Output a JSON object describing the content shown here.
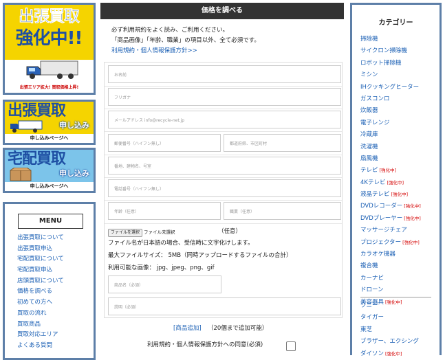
{
  "banners": {
    "b1_line1": "出張買取",
    "b1_line2": "強化中!!",
    "b1_foot": "出張エリア拡大! 買取価格上昇!",
    "b2_title": "出張買取",
    "b2_sub": "申し込み",
    "b2_foot": "申し込みページへ",
    "b3_title": "宅配買取",
    "b3_sub": "申し込み",
    "b3_foot": "申し込みページへ"
  },
  "menu": {
    "title": "MENU",
    "items": [
      "出張買取について",
      "出張買取申込",
      "宅配買取について",
      "宅配買取申込",
      "店頭買取について",
      "価格を調べる",
      "初めての方へ",
      "買取の流れ",
      "買取商品",
      "買取対応エリア",
      "よくある質問"
    ]
  },
  "form": {
    "header": "価格を調べる",
    "intro1": "必ず利用規約をよく読み、ご利用ください。",
    "intro2": "「商品画像」「年齢、職業」の項目以外、全て必須です。",
    "terms_link": "利用規約・個人情報保護方針>>",
    "placeholders": {
      "name": "お名前",
      "furigana": "フリガナ",
      "email": "メールアドレス info@recycle-net.jp",
      "zip": "郵便番号（ハイフン無し）",
      "pref": "都道府県、市区町村",
      "address": "番地、建物名、号室",
      "phone": "電話番号（ハイフン無し）",
      "age": "年齢（任意）",
      "job": "職業（任意）",
      "product": "商品名（必須）",
      "desc": "説明（必須）"
    },
    "file_button": "ファイルを選択",
    "file_status": "ファイル未選択",
    "optional": "（任意）",
    "note1": "ファイル名が日本語の場合、受信時に文字化けします。",
    "note2": "最大ファイルサイズ： 5MB（同時アップロードするファイルの合計）",
    "note3": "利用可能な画像： jpg、jpeg、png、gif",
    "add_link": "[商品追加]",
    "add_note": "（20個まで追加可能）",
    "agree_label": "利用規約・個人情報保護方針への同意(必須)"
  },
  "categories": {
    "title": "カテゴリー",
    "tag_text": "[強化中]",
    "items": [
      {
        "label": "掃除機",
        "tag": false
      },
      {
        "label": "サイクロン掃除機",
        "tag": false
      },
      {
        "label": "ロボット掃除機",
        "tag": false
      },
      {
        "label": "ミシン",
        "tag": false
      },
      {
        "label": "IHクッキングヒーター",
        "tag": false
      },
      {
        "label": "ガスコンロ",
        "tag": false
      },
      {
        "label": "炊飯器",
        "tag": false
      },
      {
        "label": "電子レンジ",
        "tag": false
      },
      {
        "label": "冷蔵庫",
        "tag": false
      },
      {
        "label": "洗濯機",
        "tag": false
      },
      {
        "label": "扇風機",
        "tag": false
      },
      {
        "label": "テレビ",
        "tag": true
      },
      {
        "label": "4Kテレビ",
        "tag": true
      },
      {
        "label": "液晶テレビ",
        "tag": true
      },
      {
        "label": "DVDレコーダー",
        "tag": true
      },
      {
        "label": "DVDプレーヤー",
        "tag": true
      },
      {
        "label": "マッサージチェア",
        "tag": false
      },
      {
        "label": "プロジェクター",
        "tag": true
      },
      {
        "label": "カラオケ機器",
        "tag": false
      },
      {
        "label": "複合機",
        "tag": false
      },
      {
        "label": "カーナビ",
        "tag": false
      },
      {
        "label": "ドローン",
        "tag": false
      },
      {
        "label": "美容器具",
        "tag": true
      }
    ],
    "brands": [
      {
        "label": "ソニー",
        "tag": false
      },
      {
        "label": "タイガー",
        "tag": false
      },
      {
        "label": "東芝",
        "tag": false
      },
      {
        "label": "ブラザー、エクシング",
        "tag": false
      },
      {
        "label": "ダイソン",
        "tag": true
      }
    ]
  }
}
